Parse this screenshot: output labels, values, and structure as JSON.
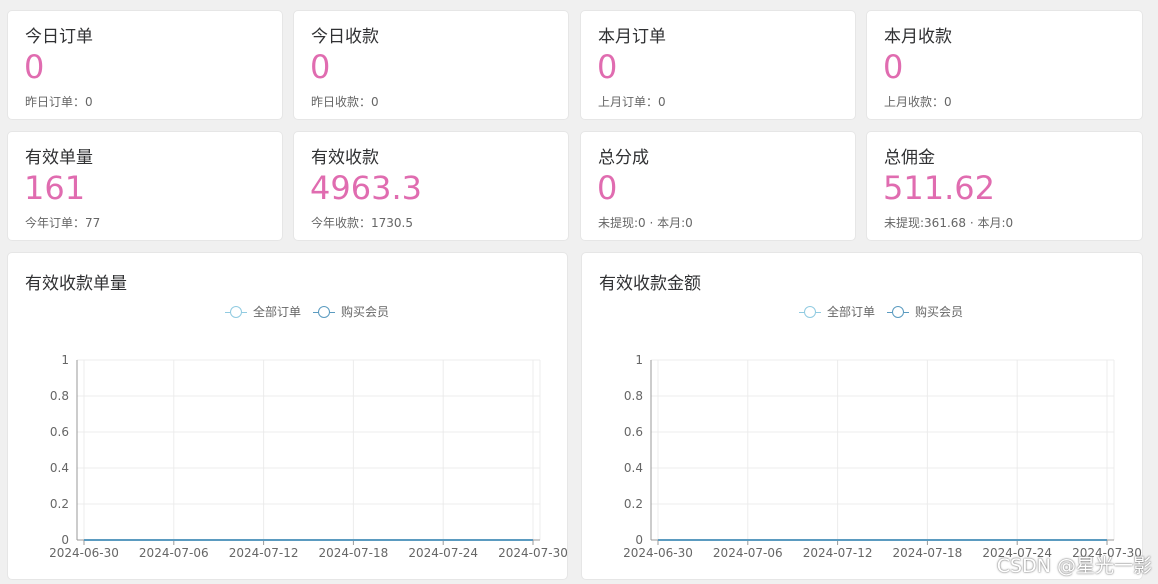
{
  "stats": [
    {
      "title": "今日订单",
      "value": "0",
      "sub": "昨日订单：0"
    },
    {
      "title": "今日收款",
      "value": "0",
      "sub": "昨日收款：0"
    },
    {
      "title": "本月订单",
      "value": "0",
      "sub": "上月订单：0"
    },
    {
      "title": "本月收款",
      "value": "0",
      "sub": "上月收款：0"
    },
    {
      "title": "有效单量",
      "value": "161",
      "sub": "今年订单：77"
    },
    {
      "title": "有效收款",
      "value": "4963.3",
      "sub": "今年收款：1730.5"
    },
    {
      "title": "总分成",
      "value": "0",
      "sub": "未提现:0 · 本月:0"
    },
    {
      "title": "总佣金",
      "value": "511.62",
      "sub": "未提现:361.68 · 本月:0"
    }
  ],
  "chart_data": [
    {
      "type": "line",
      "title": "有效收款单量",
      "x": [
        "2024-06-30",
        "2024-07-06",
        "2024-07-12",
        "2024-07-18",
        "2024-07-24",
        "2024-07-30"
      ],
      "series": [
        {
          "name": "全部订单",
          "values": [
            0,
            0,
            0,
            0,
            0,
            0
          ],
          "color": "#91cbe1"
        },
        {
          "name": "购买会员",
          "values": [
            0,
            0,
            0,
            0,
            0,
            0
          ],
          "color": "#5b9bc0"
        }
      ],
      "ylim": [
        0,
        1
      ],
      "yticks": [
        "0",
        "0.2",
        "0.4",
        "0.6",
        "0.8",
        "1"
      ],
      "grid": true,
      "legend": "top-center"
    },
    {
      "type": "line",
      "title": "有效收款金额",
      "x": [
        "2024-06-30",
        "2024-07-06",
        "2024-07-12",
        "2024-07-18",
        "2024-07-24",
        "2024-07-30"
      ],
      "series": [
        {
          "name": "全部订单",
          "values": [
            0,
            0,
            0,
            0,
            0,
            0
          ],
          "color": "#91cbe1"
        },
        {
          "name": "购买会员",
          "values": [
            0,
            0,
            0,
            0,
            0,
            0
          ],
          "color": "#5b9bc0"
        }
      ],
      "ylim": [
        0,
        1
      ],
      "yticks": [
        "0",
        "0.2",
        "0.4",
        "0.6",
        "0.8",
        "1"
      ],
      "grid": true,
      "legend": "top-center"
    }
  ],
  "watermark": "CSDN @星光一影"
}
